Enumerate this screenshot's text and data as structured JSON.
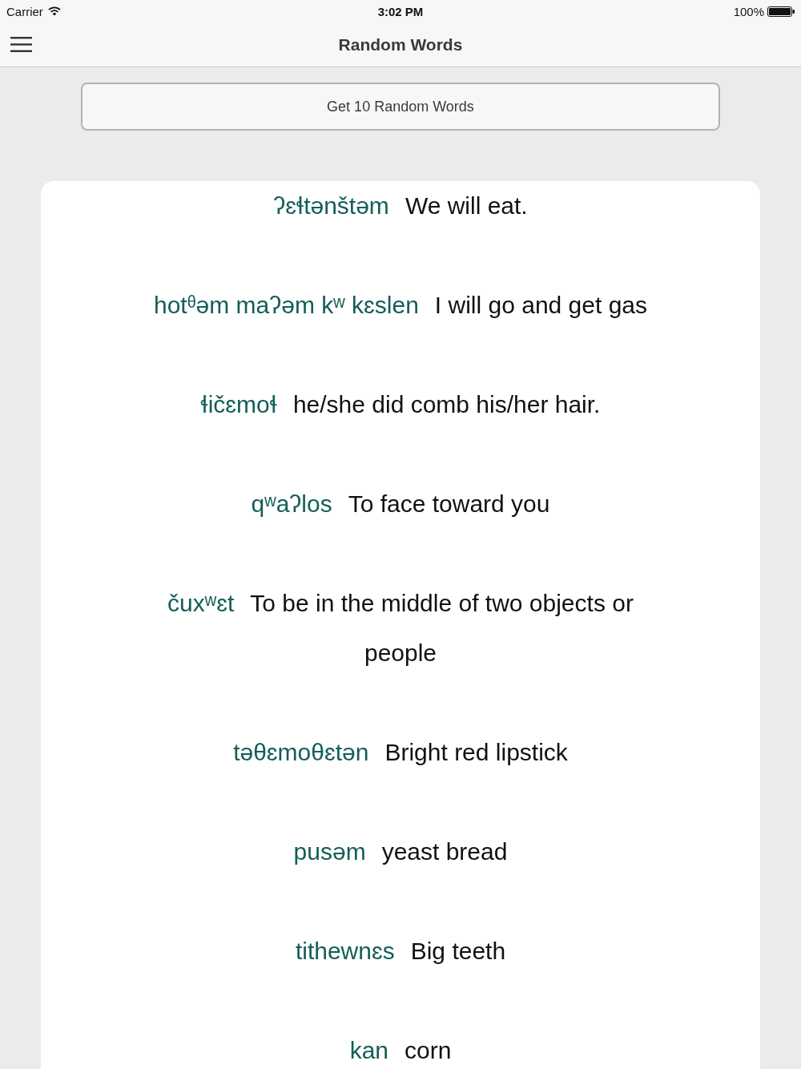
{
  "status_bar": {
    "carrier": "Carrier",
    "time": "3:02 PM",
    "battery": "100%"
  },
  "nav_bar": {
    "title": "Random Words"
  },
  "action_button": {
    "label": "Get 10 Random Words"
  },
  "words": [
    {
      "word": "ʔɛɬtənštəm",
      "translation": "We will eat."
    },
    {
      "word": "hotᶿəm maʔəm kʷ kɛslen",
      "translation": "I will go and get gas"
    },
    {
      "word": "ɬičɛmoɬ",
      "translation": "he/she did comb his/her hair."
    },
    {
      "word": "qʷaʔlos",
      "translation": "To face toward you"
    },
    {
      "word": "čuxʷɛt",
      "translation": "To be in the middle of two objects or people"
    },
    {
      "word": "təθɛmoθɛtən",
      "translation": "Bright red lipstick"
    },
    {
      "word": "pusəm",
      "translation": "yeast bread"
    },
    {
      "word": "tithewnɛs",
      "translation": "Big teeth"
    },
    {
      "word": "kan",
      "translation": "corn"
    }
  ]
}
